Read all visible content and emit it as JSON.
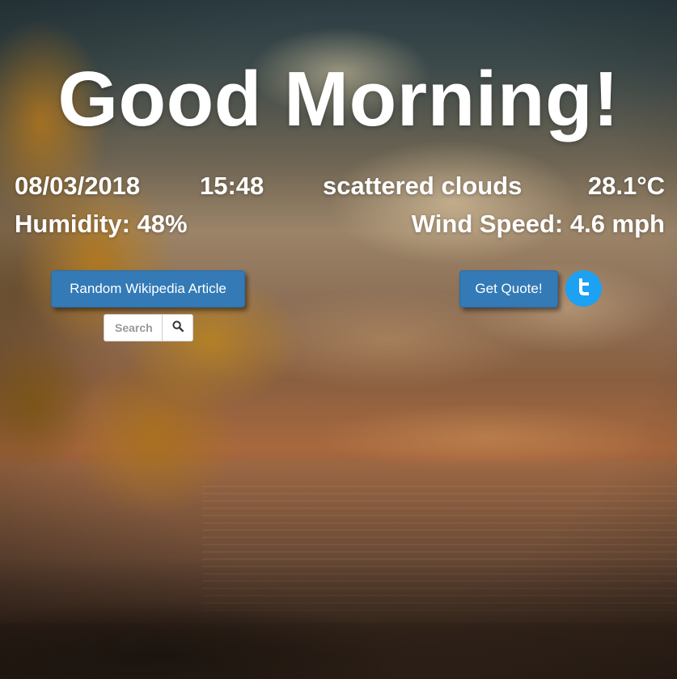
{
  "greeting": "Good Morning!",
  "weather": {
    "date": "08/03/2018",
    "time": "15:48",
    "description": "scattered clouds",
    "temperature": "28.1°C",
    "humidity": "Humidity: 48%",
    "wind_speed": "Wind Speed: 4.6 mph"
  },
  "actions": {
    "wiki_button_label": "Random Wikipedia Article",
    "search_placeholder": "Search",
    "search_icon": "magnifier-icon",
    "quote_button_label": "Get Quote!",
    "twitter_icon": "twitter-icon"
  },
  "colors": {
    "button_primary": "#337ab7",
    "twitter_blue": "#1da1f2",
    "text": "#ffffff"
  }
}
